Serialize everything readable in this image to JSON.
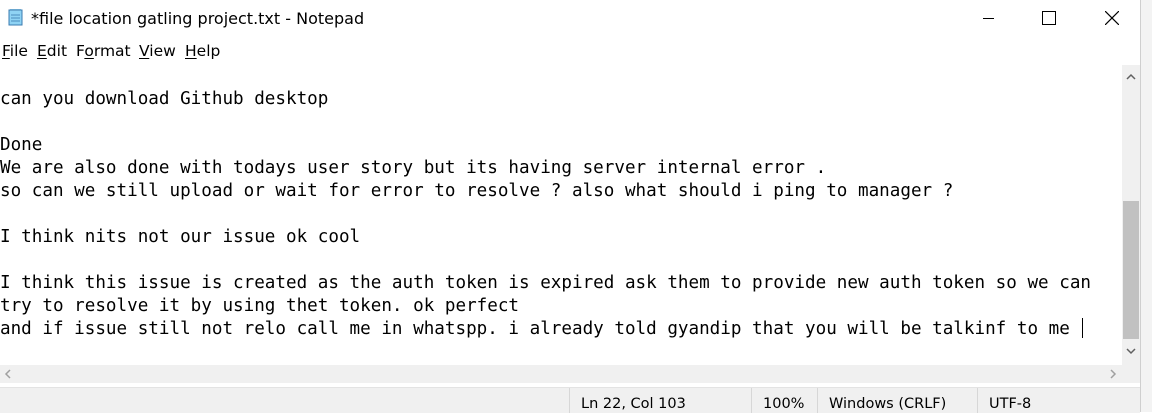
{
  "window": {
    "title": "*file location gatling project.txt - Notepad",
    "icon": "notepad-icon"
  },
  "controls": {
    "minimize_icon": "minimize-icon",
    "maximize_icon": "maximize-icon",
    "close_icon": "close-icon"
  },
  "menu": {
    "items": [
      {
        "accel": "F",
        "rest": "ile"
      },
      {
        "accel": "E",
        "rest": "dit"
      },
      {
        "pre": "F",
        "accel": "o",
        "rest": "rmat"
      },
      {
        "accel": "V",
        "rest": "iew"
      },
      {
        "accel": "H",
        "rest": "elp"
      }
    ]
  },
  "editor": {
    "lines": [
      "",
      "can you download Github desktop",
      "",
      "Done",
      "We are also done with todays user story but its having server internal error .",
      "so can we still upload or wait for error to resolve ? also what should i ping to manager ?",
      "",
      "I think nits not our issue ok cool",
      "",
      "I think this issue is created as the auth token is expired ask them to provide new auth token so we can",
      "try to resolve it by using thet token. ok perfect",
      "and if issue still not relo call me in whatspp. i already told gyandip that you will be talkinf to me "
    ]
  },
  "status": {
    "position": "Ln 22, Col 103",
    "zoom": "100%",
    "line_ending": "Windows (CRLF)",
    "encoding": "UTF-8"
  }
}
